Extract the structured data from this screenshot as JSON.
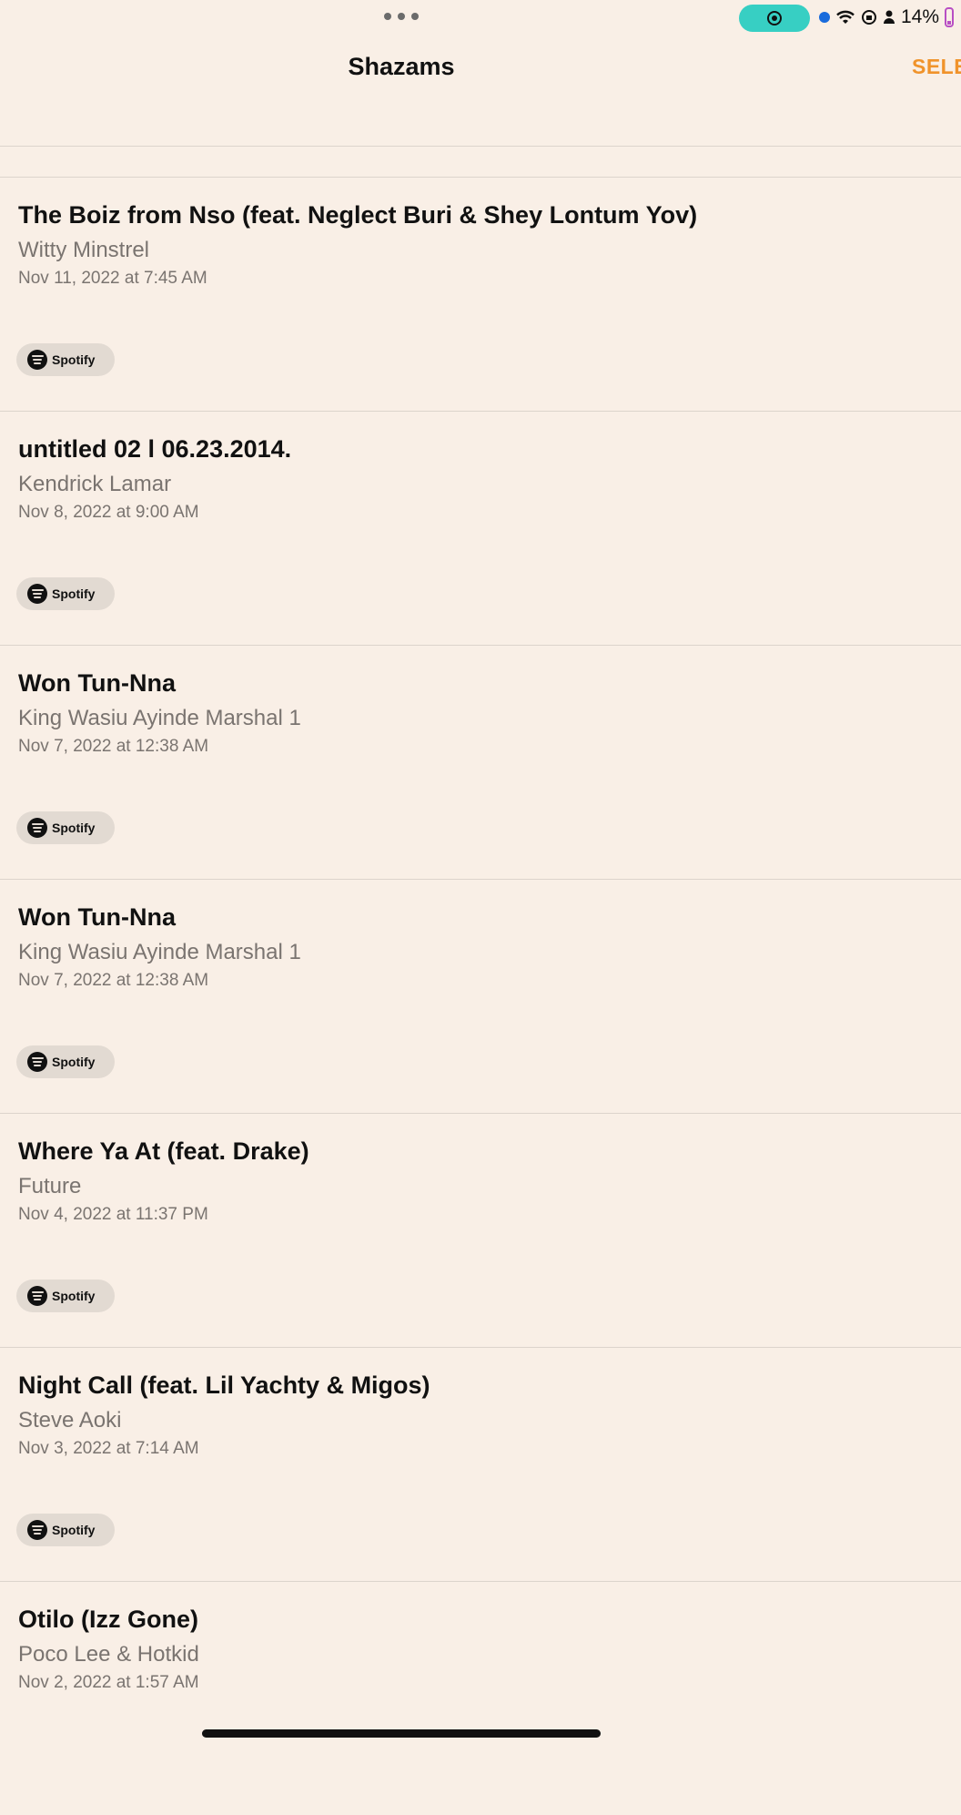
{
  "status_bar": {
    "battery_text": "14%"
  },
  "nav": {
    "title": "Shazams",
    "select_label": "SELE"
  },
  "spotify_label": "Spotify",
  "items": [
    {
      "title": "The Boiz from Nso (feat. Neglect Buri & Shey Lontum Yov)",
      "artist": "Witty Minstrel",
      "date": "Nov 11, 2022 at 7:45 AM"
    },
    {
      "title": "untitled 02 l 06.23.2014.",
      "artist": "Kendrick Lamar",
      "date": "Nov 8, 2022 at 9:00 AM"
    },
    {
      "title": "Won Tun-Nna",
      "artist": "King Wasiu Ayinde Marshal 1",
      "date": "Nov 7, 2022 at 12:38 AM"
    },
    {
      "title": "Won Tun-Nna",
      "artist": "King Wasiu Ayinde Marshal 1",
      "date": "Nov 7, 2022 at 12:38 AM"
    },
    {
      "title": "Where Ya At (feat. Drake)",
      "artist": "Future",
      "date": "Nov 4, 2022 at 11:37 PM"
    },
    {
      "title": "Night Call (feat. Lil Yachty & Migos)",
      "artist": "Steve Aoki",
      "date": "Nov 3, 2022 at 7:14 AM"
    },
    {
      "title": "Otilo (Izz Gone)",
      "artist": "Poco Lee & Hotkid",
      "date": "Nov 2, 2022 at 1:57 AM"
    }
  ]
}
